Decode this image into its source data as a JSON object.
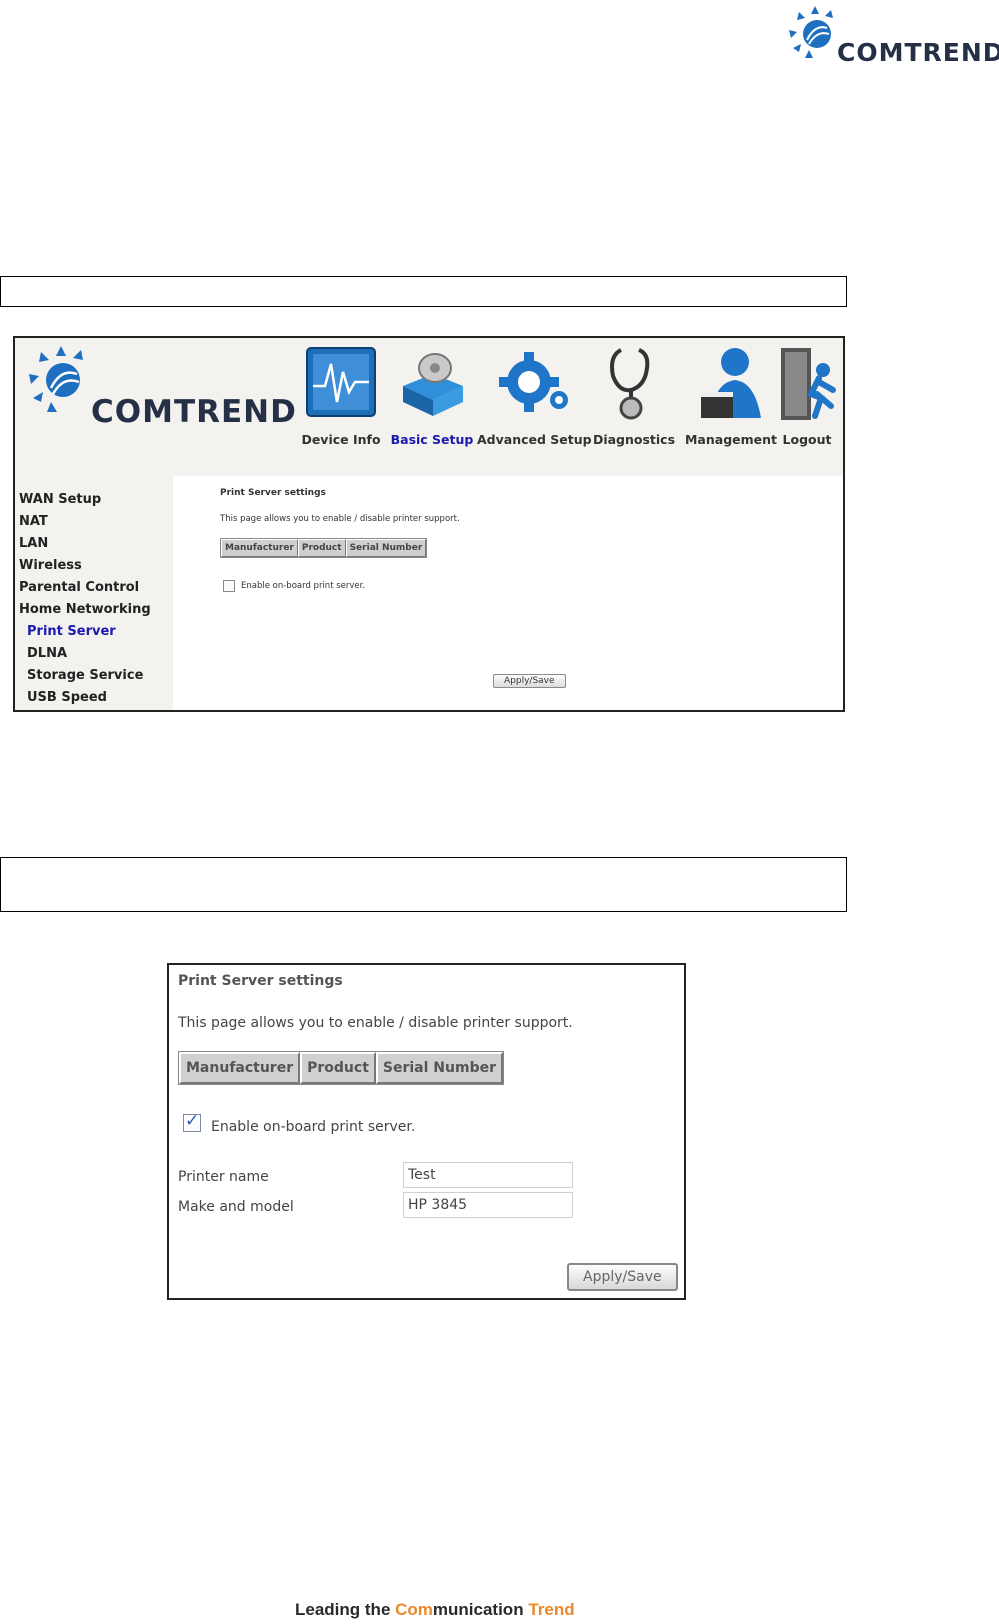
{
  "brand": {
    "name": "COMTREND",
    "accent": "#253047",
    "dot_color": "#1e6fbf"
  },
  "screenshot1": {
    "nav": [
      {
        "label": "Device Info",
        "icon": "device-info-icon"
      },
      {
        "label": "Basic Setup",
        "icon": "basic-setup-icon",
        "active": true
      },
      {
        "label": "Advanced Setup",
        "icon": "advanced-setup-icon"
      },
      {
        "label": "Diagnostics",
        "icon": "diagnostics-icon"
      },
      {
        "label": "Management",
        "icon": "management-icon"
      },
      {
        "label": "Logout",
        "icon": "logout-icon"
      }
    ],
    "sidebar": [
      {
        "label": "WAN Setup"
      },
      {
        "label": "NAT"
      },
      {
        "label": "LAN"
      },
      {
        "label": "Wireless"
      },
      {
        "label": "Parental Control"
      },
      {
        "label": "Home Networking"
      },
      {
        "label": "Print Server",
        "active": true
      },
      {
        "label": "DLNA"
      },
      {
        "label": "Storage Service"
      },
      {
        "label": "USB Speed"
      }
    ],
    "title": "Print Server settings",
    "description": "This page allows you to enable / disable printer support.",
    "table_headers": [
      "Manufacturer",
      "Product",
      "Serial Number"
    ],
    "checkbox_label": "Enable on-board print server.",
    "checkbox_checked": false,
    "apply_label": "Apply/Save"
  },
  "screenshot2": {
    "title": "Print Server settings",
    "description": "This page allows you to enable / disable printer support.",
    "table_headers": [
      "Manufacturer",
      "Product",
      "Serial Number"
    ],
    "checkbox_label": "Enable on-board print server.",
    "checkbox_checked": true,
    "fields": [
      {
        "label": "Printer name",
        "value": "Test"
      },
      {
        "label": "Make and model",
        "value": "HP 3845"
      }
    ],
    "apply_label": "Apply/Save"
  },
  "footer": {
    "part1": "Leading the ",
    "part2": "Com",
    "part3": "munication ",
    "part4": "Trend"
  }
}
